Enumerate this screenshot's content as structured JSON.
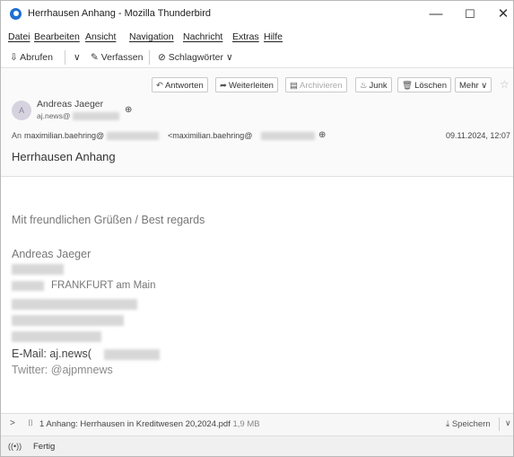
{
  "window": {
    "title": "Herrhausen Anhang - Mozilla Thunderbird",
    "controls": {
      "minimize": "—",
      "maximize": "☐",
      "close": "✕"
    }
  },
  "menu": [
    "Datei",
    "Bearbeiten",
    "Ansicht",
    "Navigation",
    "Nachricht",
    "Extras",
    "Hilfe"
  ],
  "toolbar": {
    "get_mail": "Abrufen",
    "compose": "Verfassen",
    "tags": "Schlagwörter"
  },
  "actions": {
    "reply": "Antworten",
    "forward": "Weiterleiten",
    "archive": "Archivieren",
    "junk": "Junk",
    "delete": "Löschen",
    "more": "Mehr"
  },
  "header": {
    "avatar_initial": "A",
    "from_name": "Andreas Jaeger",
    "from_email": "aj.news@",
    "to_label": "An",
    "to_name": "maximilian.baehring@",
    "to_email": "<maximilian.baehring@",
    "date": "09.11.2024, 12:07",
    "subject": "Herrhausen Anhang"
  },
  "body": {
    "greeting": "Mit freundlichen Grüßen / Best regards",
    "name": "Andreas Jaeger",
    "city": "FRANKFURT am Main",
    "email": "E-Mail: aj.news(",
    "twitter": "Twitter: @ajpmnews"
  },
  "attachment": {
    "summary": "1 Anhang: Herrhausen in Kreditwesen 20,2024.pdf",
    "size": "1,9 MB",
    "save": "Speichern"
  },
  "status": {
    "text": "Fertig"
  },
  "colors": {
    "accent": "#1f6fd1",
    "header_bg": "#fafafa",
    "body_text": "#777777"
  }
}
